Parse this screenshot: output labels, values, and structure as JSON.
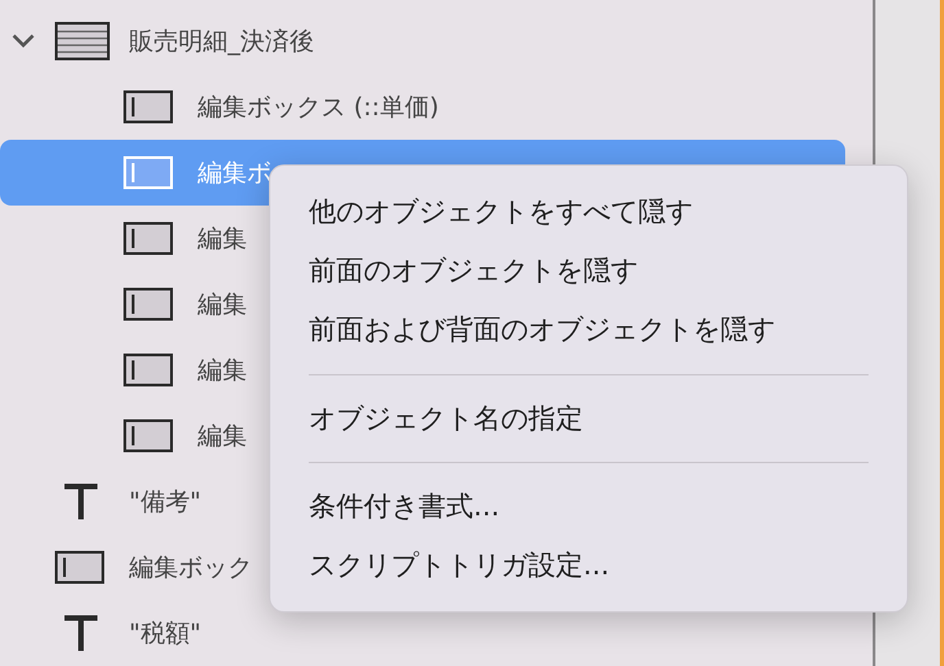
{
  "tree": [
    {
      "kind": "table",
      "label": "販売明細_決済後",
      "expanded": true,
      "selected": false,
      "children": [
        {
          "kind": "editbox",
          "label": "編集ボックス (::単価)",
          "selected": false
        },
        {
          "kind": "editbox",
          "label": "編集ボ",
          "selected": true
        },
        {
          "kind": "editbox",
          "label": "編集",
          "selected": false
        },
        {
          "kind": "editbox",
          "label": "編集",
          "selected": false
        },
        {
          "kind": "editbox",
          "label": "編集",
          "selected": false
        },
        {
          "kind": "editbox",
          "label": "編集",
          "selected": false
        }
      ]
    },
    {
      "kind": "text",
      "label": "\"備考\"",
      "selected": false
    },
    {
      "kind": "editbox",
      "label": "編集ボック",
      "selected": false
    },
    {
      "kind": "text",
      "label": "\"税額\"",
      "selected": false
    }
  ],
  "context_menu": {
    "items": [
      {
        "kind": "item",
        "label": "他のオブジェクトをすべて隠す"
      },
      {
        "kind": "item",
        "label": "前面のオブジェクトを隠す"
      },
      {
        "kind": "item",
        "label": "前面および背面のオブジェクトを隠す"
      },
      {
        "kind": "separator"
      },
      {
        "kind": "item",
        "label": "オブジェクト名の指定"
      },
      {
        "kind": "separator"
      },
      {
        "kind": "item",
        "label": "条件付き書式..."
      },
      {
        "kind": "item",
        "label": "スクリプトトリガ設定..."
      }
    ]
  }
}
